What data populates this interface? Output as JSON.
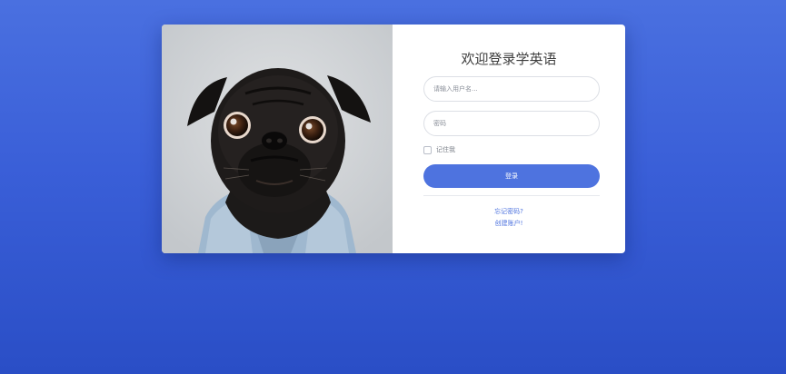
{
  "colors": {
    "page_gradient_top": "#4a70e0",
    "page_gradient_bottom": "#2a4ec6",
    "accent": "#4e73df",
    "card": "#ffffff"
  },
  "login": {
    "title": "欢迎登录学英语",
    "username_placeholder": "请输入用户名...",
    "password_placeholder": "密码",
    "remember_label": "记住我",
    "remember_checked": false,
    "login_button": "登录",
    "forgot_link": "忘记密码?",
    "create_link": "创建账户!"
  },
  "image": {
    "subject": "pug-dog-in-denim-jacket"
  }
}
